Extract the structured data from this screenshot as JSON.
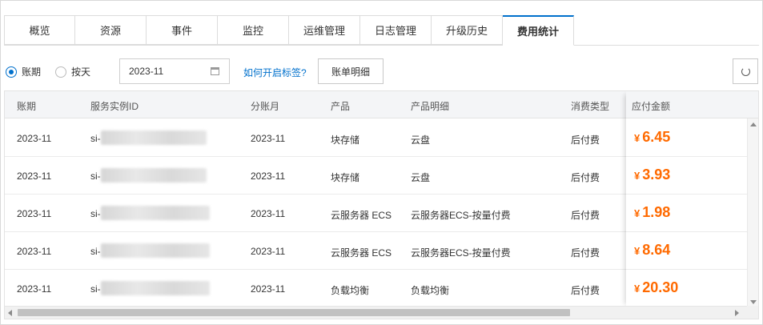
{
  "tabs": [
    {
      "label": "概览"
    },
    {
      "label": "资源"
    },
    {
      "label": "事件"
    },
    {
      "label": "监控"
    },
    {
      "label": "运维管理"
    },
    {
      "label": "日志管理"
    },
    {
      "label": "升级历史"
    },
    {
      "label": "费用统计",
      "active": true
    }
  ],
  "toolbar": {
    "radio_billing": "账期",
    "radio_daily": "按天",
    "date_value": "2023-11",
    "help_link": "如何开启标签?",
    "detail_button": "账单明细"
  },
  "table": {
    "columns": [
      "账期",
      "服务实例ID",
      "分账月",
      "产品",
      "产品明细",
      "消费类型",
      "应付金额"
    ],
    "currency_symbol": "¥",
    "rows": [
      {
        "period": "2023-11",
        "instance_prefix": "si-",
        "split_month": "2023-11",
        "product": "块存储",
        "detail": "云盘",
        "type": "后付费",
        "amount": "6.45"
      },
      {
        "period": "2023-11",
        "instance_prefix": "si-",
        "split_month": "2023-11",
        "product": "块存储",
        "detail": "云盘",
        "type": "后付费",
        "amount": "3.93"
      },
      {
        "period": "2023-11",
        "instance_prefix": "si-",
        "split_month": "2023-11",
        "product": "云服务器 ECS",
        "detail": "云服务器ECS-按量付费",
        "type": "后付费",
        "amount": "1.98"
      },
      {
        "period": "2023-11",
        "instance_prefix": "si-",
        "split_month": "2023-11",
        "product": "云服务器 ECS",
        "detail": "云服务器ECS-按量付费",
        "type": "后付费",
        "amount": "8.64"
      },
      {
        "period": "2023-11",
        "instance_prefix": "si-",
        "split_month": "2023-11",
        "product": "负载均衡",
        "detail": "负载均衡",
        "type": "后付费",
        "amount": "20.30"
      }
    ]
  },
  "colors": {
    "accent": "#0070cc",
    "amount": "#ff6a00"
  }
}
